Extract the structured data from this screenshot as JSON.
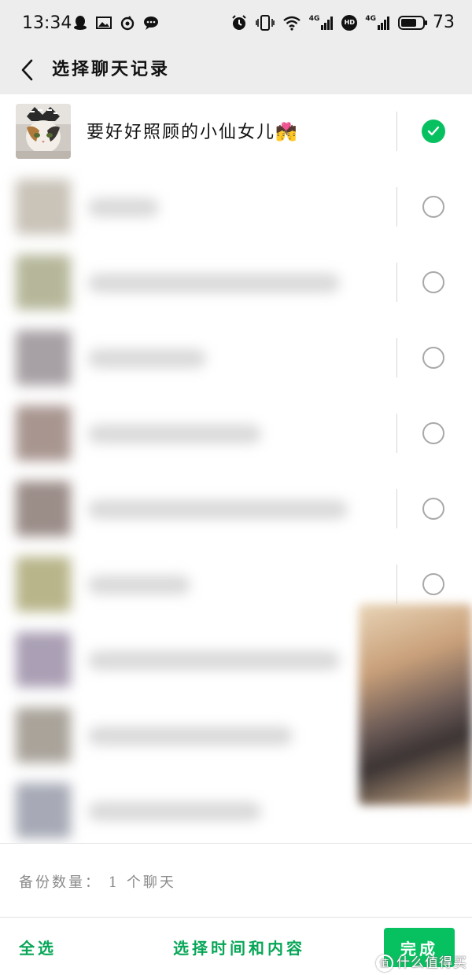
{
  "status_bar": {
    "time": "13:34",
    "battery_level": "73",
    "battery_fraction": 0.73,
    "left_icons": [
      "qq-icon",
      "gallery-icon",
      "netease-music-icon",
      "chat-bubble-icon"
    ],
    "right_icons": [
      "alarm-icon",
      "vibrate-icon",
      "wifi-icon",
      "signal-4g-icon",
      "hd-icon",
      "signal-4g-icon",
      "battery-icon"
    ],
    "network_label": "4G",
    "hd_label": "HD"
  },
  "header": {
    "title": "选择聊天记录",
    "back_icon": "chevron-left-icon"
  },
  "chats": [
    {
      "name": "要好好照顾的小仙女儿💏",
      "selected": true,
      "blurred": false
    },
    {
      "name": "",
      "selected": false,
      "blurred": true
    },
    {
      "name": "",
      "selected": false,
      "blurred": true
    },
    {
      "name": "",
      "selected": false,
      "blurred": true
    },
    {
      "name": "",
      "selected": false,
      "blurred": true
    },
    {
      "name": "",
      "selected": false,
      "blurred": true
    },
    {
      "name": "",
      "selected": false,
      "blurred": true
    },
    {
      "name": "",
      "selected": false,
      "blurred": true
    },
    {
      "name": "",
      "selected": false,
      "blurred": true
    },
    {
      "name": "",
      "selected": false,
      "blurred": true
    }
  ],
  "footer": {
    "backup_count": "备份数量：  1 个聊天",
    "select_all": "全选",
    "select_range": "选择时间和内容",
    "done": "完成"
  },
  "watermark": {
    "logo": "值",
    "text": "什么值得买"
  },
  "colors": {
    "accent": "#07c160",
    "accent_text": "#07a657",
    "header_bg": "#ededed",
    "radio_border": "#a8a8a8"
  }
}
